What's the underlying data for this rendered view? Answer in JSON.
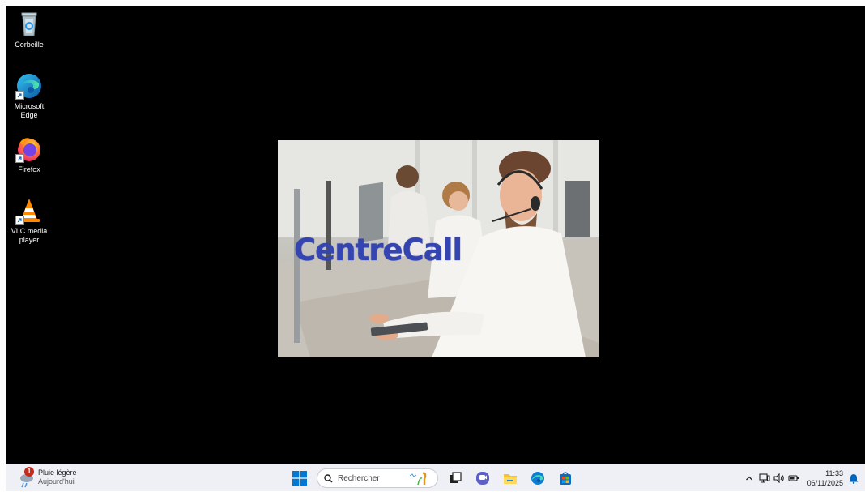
{
  "desktop": {
    "icons": [
      {
        "label": "Corbeille",
        "icon": "recycle-bin-icon"
      },
      {
        "label": "Microsoft\nEdge",
        "icon": "edge-icon"
      },
      {
        "label": "Firefox",
        "icon": "firefox-icon"
      },
      {
        "label": "VLC media\nplayer",
        "icon": "vlc-icon"
      }
    ]
  },
  "splash": {
    "brand": "CentreCall",
    "brand_color": "#3445b2"
  },
  "taskbar": {
    "weather": {
      "title": "Pluie légère",
      "subtitle": "Aujourd'hui",
      "badge": "1"
    },
    "search": {
      "placeholder": "Rechercher"
    },
    "pinned": [
      "windows-start-icon",
      "task-view-icon",
      "teams-chat-icon",
      "file-explorer-icon",
      "edge-icon",
      "microsoft-store-icon"
    ],
    "tray": {
      "time": "11:33",
      "date": "06/11/2025",
      "icons": [
        "chevron-up-icon",
        "network-icon",
        "volume-icon",
        "battery-icon",
        "notification-bell-icon"
      ]
    }
  },
  "colors": {
    "desktop_bg": "#000000",
    "taskbar_bg": "#eef0f5",
    "accent": "#0067c0"
  }
}
